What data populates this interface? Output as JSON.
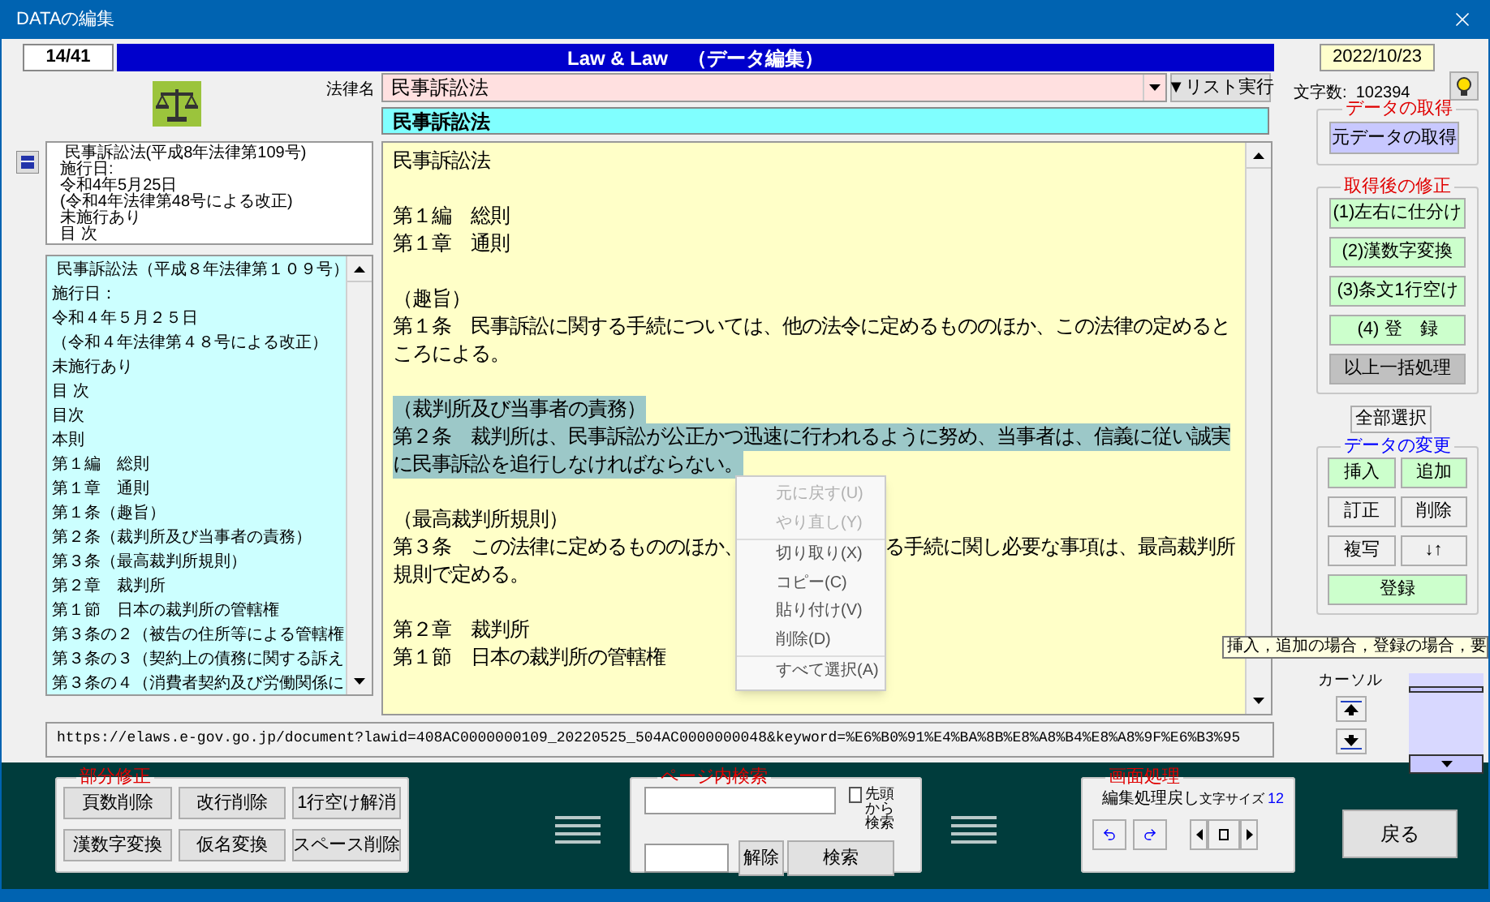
{
  "window": {
    "title": "DATAの編集"
  },
  "header": {
    "record": "14/41",
    "title": "Law & Law　（データ編集）",
    "date": "2022/10/23"
  },
  "law_name": {
    "label": "法律名",
    "value": "民事訴訟法",
    "list_button": "▼リスト実行"
  },
  "char_count": "文字数:  102394",
  "section_title": "民事訴訟法",
  "info_lines": [
    " 民事訴訟法(平成8年法律第109号)",
    "施行日:",
    "令和4年5月25日",
    "(令和4年法律第48号による改正)",
    "未施行あり",
    "目 次"
  ],
  "toc": [
    " 民事訴訟法（平成８年法律第１０９号）",
    "施行日：",
    "令和４年５月２５日",
    "（令和４年法律第４８号による改正）",
    "未施行あり",
    "目 次",
    "目次",
    "本則",
    "第１編　総則",
    "第１章　通則",
    "第１条（趣旨）",
    "第２条（裁判所及び当事者の責務）",
    "第３条（最高裁判所規則）",
    "第２章　裁判所",
    "第１節　日本の裁判所の管轄権",
    "第３条の２（被告の住所等による管轄権",
    "第３条の３（契約上の債務に関する訴え",
    "第３条の４（消費者契約及び労働関係に"
  ],
  "editor": {
    "blocks": [
      {
        "selected": false,
        "lines": [
          {
            "kind": "line",
            "text": "民事訴訟法"
          }
        ]
      },
      {
        "selected": false,
        "lines": [
          {
            "kind": "line",
            "text": "第１編　総則"
          },
          {
            "kind": "line",
            "text": "第１章　通則"
          }
        ]
      },
      {
        "selected": false,
        "lines": [
          {
            "kind": "line",
            "text": "（趣旨）"
          },
          {
            "kind": "line",
            "text": "第１条　民事訴訟に関する手続については、他の法令に定めるもののほか、この法律の定めると"
          },
          {
            "kind": "line",
            "text": "ころによる。"
          }
        ]
      },
      {
        "selected": true,
        "lines": [
          {
            "kind": "line",
            "text": "（裁判所及び当事者の責務）"
          },
          {
            "kind": "line",
            "text": "第２条　裁判所は、民事訴訟が公正かつ迅速に行われるように努め、当事者は、信義に従い誠実"
          },
          {
            "kind": "line",
            "text": "に民事訴訟を追行しなければならない。"
          }
        ]
      },
      {
        "selected": false,
        "lines": [
          {
            "kind": "line",
            "text": "（最高裁判所規則）"
          },
          {
            "kind": "split",
            "parts": [
              "第３条　この法律に定めるもののほか、",
              "る手続に関し必要な事項は、最高裁判所"
            ]
          },
          {
            "kind": "line",
            "text": "規則で定める。"
          }
        ]
      },
      {
        "selected": false,
        "lines": [
          {
            "kind": "line",
            "text": "第２章　裁判所"
          },
          {
            "kind": "line",
            "text": "第１節　日本の裁判所の管轄権"
          }
        ]
      }
    ]
  },
  "context_menu": [
    {
      "kind": "item",
      "label": "元に戻す(U)",
      "disabled": true
    },
    {
      "kind": "item",
      "label": "やり直し(Y)",
      "disabled": true
    },
    {
      "kind": "separator"
    },
    {
      "kind": "item",
      "label": "切り取り(X)",
      "disabled": false
    },
    {
      "kind": "item",
      "label": "コピー(C)",
      "disabled": false
    },
    {
      "kind": "item",
      "label": "貼り付け(V)",
      "disabled": false
    },
    {
      "kind": "item",
      "label": "削除(D)",
      "disabled": false
    },
    {
      "kind": "separator"
    },
    {
      "kind": "item",
      "label": "すべて選択(A)",
      "disabled": false
    }
  ],
  "url": "https://elaws.e-gov.go.jp/document?lawid=408AC0000000109_20220525_504AC0000000048&keyword=%E6%B0%91%E4%BA%8B%E8%A8%B4%E8%A8%9F%E6%B3%95",
  "data_get": {
    "title": "データの取得",
    "button": "元データの取得"
  },
  "after_fix": {
    "title": "取得後の修正",
    "buttons": [
      {
        "label": "(1)左右に仕分け",
        "color": "#ccffcc"
      },
      {
        "label": "(2)漢数字変換",
        "color": "#ccffcc"
      },
      {
        "label": "(3)条文1行空け",
        "color": "#ccffcc"
      },
      {
        "label": "(4) 登　録",
        "color": "#ccffcc"
      },
      {
        "label": "以上一括処理",
        "color": "#c0c0c0"
      }
    ]
  },
  "select_all": "全部選択",
  "data_change": {
    "title": "データの変更",
    "buttons": [
      {
        "label": "挿入",
        "color": "#ccffcc"
      },
      {
        "label": "追加",
        "color": "#ccffcc"
      },
      {
        "label": "訂正",
        "color": "#f0f0f0"
      },
      {
        "label": "削除",
        "color": "#f0f0f0"
      },
      {
        "label": "複写",
        "color": "#f0f0f0"
      },
      {
        "label": "↓↑",
        "color": "#f0f0f0"
      }
    ],
    "register": "登録"
  },
  "tooltip": "挿入，追加の場合，登録の場合，要",
  "cursor_label": "カーソル",
  "partial_fix": {
    "title": "部分修正",
    "buttons": [
      "頁数削除",
      "改行削除",
      "1行空け解消",
      "漢数字変換",
      "仮名変換",
      "スペース削除"
    ]
  },
  "page_search": {
    "title": "ページ内検索",
    "from_start": {
      "label_lines": [
        "先頭から",
        "検索"
      ],
      "checked": false
    },
    "clear": "解除",
    "search": "検索"
  },
  "screen": {
    "title": "画面処理",
    "undo_label": "編集処理戻し",
    "font_size_label": "文字サイズ",
    "font_size": "12"
  },
  "back": "戻る"
}
